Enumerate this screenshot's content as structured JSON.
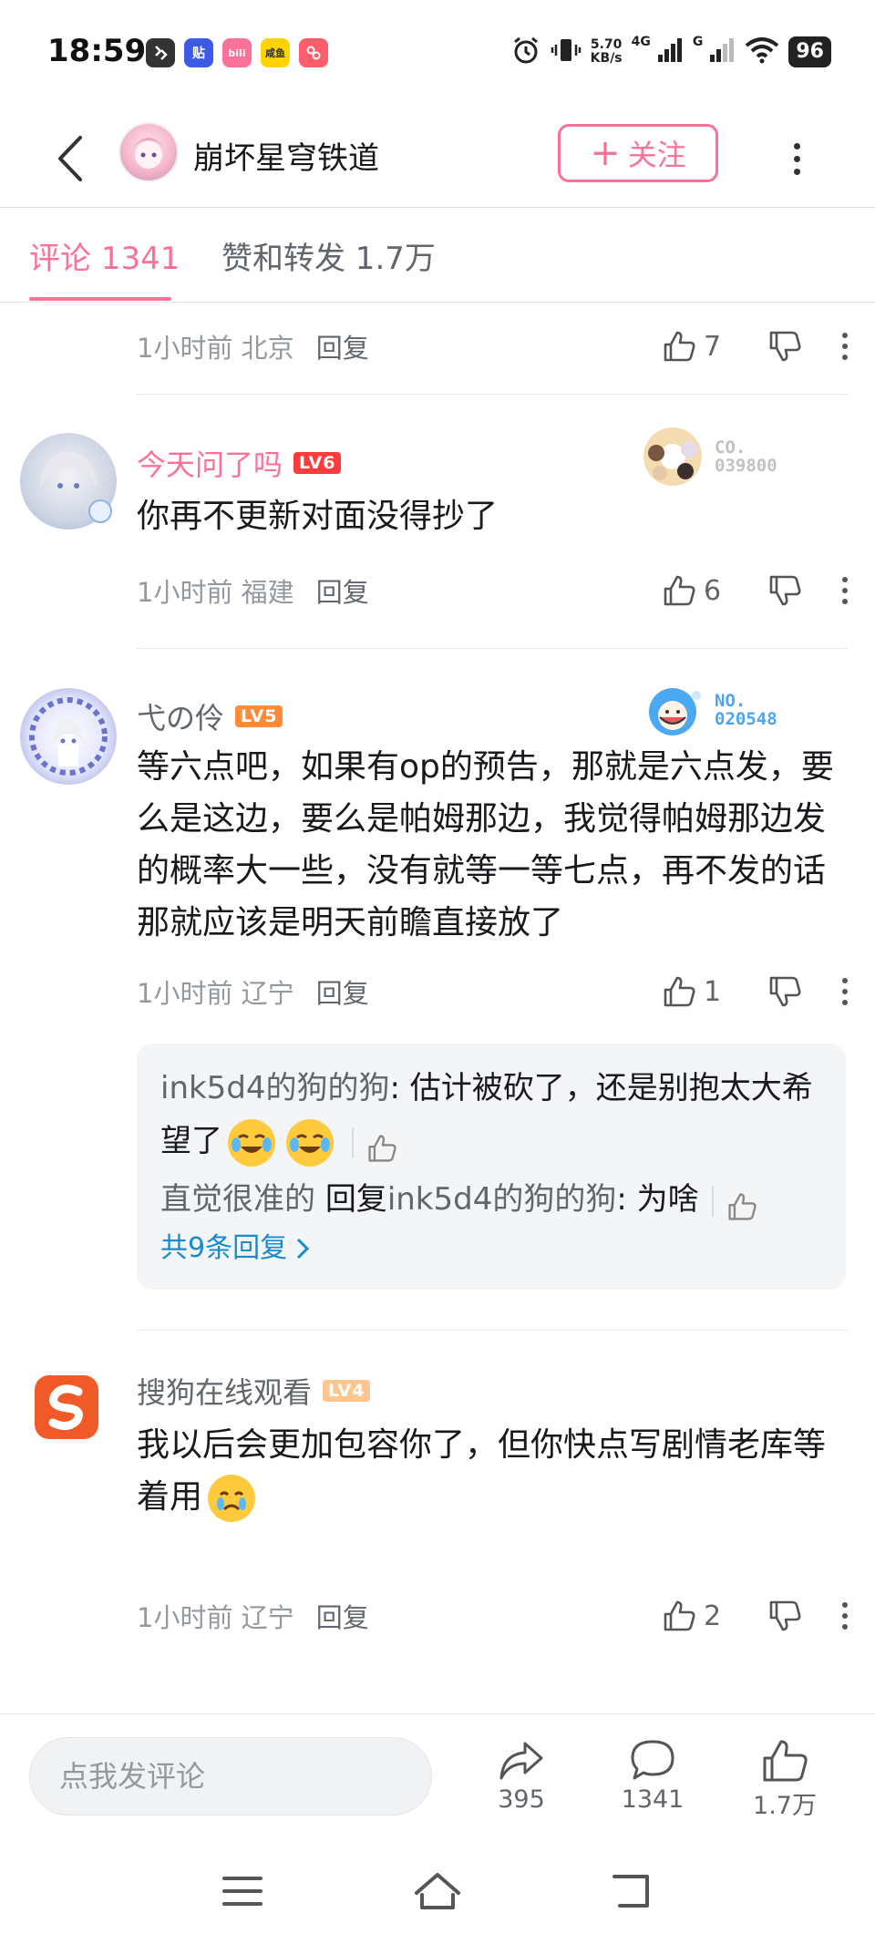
{
  "status_bar": {
    "time": "18:59",
    "net_speed_value": "5.70",
    "net_speed_unit": "KB/s",
    "net_gen_1": "4G",
    "net_gen_2": "G",
    "battery": "96",
    "app_icons": [
      {
        "name": "app-icon-1",
        "label": "",
        "color": "#333333"
      },
      {
        "name": "app-icon-2",
        "label": "贴",
        "color": "#3d59e8"
      },
      {
        "name": "app-icon-3",
        "label": "bili",
        "color": "#fb7299"
      },
      {
        "name": "app-icon-4",
        "label": "咸鱼",
        "color": "#ffd400"
      },
      {
        "name": "app-icon-5",
        "label": "",
        "color": "#ff5c6c"
      }
    ]
  },
  "header": {
    "title": "崩坏星穹铁道",
    "follow_label": "关注",
    "follow_plus": "+"
  },
  "tabs": [
    {
      "label": "评论 1341",
      "active": true
    },
    {
      "label": "赞和转发 1.7万",
      "active": false
    }
  ],
  "comments": [
    {
      "partial": true,
      "time": "1小时前",
      "location": "北京",
      "reply_label": "回复",
      "likes": "7"
    },
    {
      "username": "今天问了吗",
      "level": "LV6",
      "level_color": "#fb3c3c",
      "text": "你再不更新对面没得抄了",
      "badge_no": "CO.\n039800",
      "badge_color": "#c9c9c9",
      "time": "1小时前",
      "location": "福建",
      "reply_label": "回复",
      "likes": "6"
    },
    {
      "username": "弋の伶",
      "level": "LV5",
      "level_color": "#ff8a37",
      "text": "等六点吧，如果有op的预告，那就是六点发，要么是这边，要么是帕姆那边，我觉得帕姆那边发的概率大一些，没有就等一等七点，再不发的话那就应该是明天前瞻直接放了",
      "badge_no": "NO.\n020548",
      "badge_color": "#4ea5ee",
      "time": "1小时前",
      "location": "辽宁",
      "reply_label": "回复",
      "likes": "1",
      "replies": [
        {
          "name": "ink5d4的狗的狗",
          "text": "估计被砍了，还是别抱太大希望了",
          "emojis": 2
        },
        {
          "name": "直觉很准的",
          "reply_word": "回复",
          "reply_to": "ink5d4的狗的狗",
          "text": "为啥"
        }
      ],
      "more_replies": "共9条回复"
    },
    {
      "username": "搜狗在线观看",
      "level": "LV4",
      "level_color": "#ffc58f",
      "text": "我以后会更加包容你了，但你快点写剧情老库等着用",
      "time": "1小时前",
      "location": "辽宁",
      "reply_label": "回复",
      "likes": "2"
    }
  ],
  "bottom_bar": {
    "input_placeholder": "点我发评论",
    "share_count": "395",
    "comment_count": "1341",
    "like_count": "1.7万"
  },
  "colors": {
    "accent": "#fb7299",
    "link": "#178bcf",
    "text_secondary": "#61666d",
    "text_tertiary": "#9499a0"
  }
}
